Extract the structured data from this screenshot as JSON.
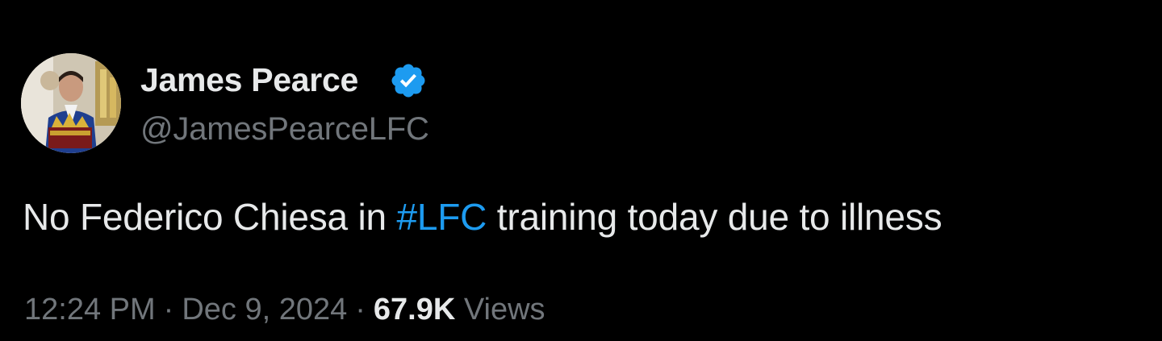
{
  "author": {
    "display_name": "James Pearce",
    "handle": "@JamesPearceLFC",
    "verified": true,
    "avatar_icon": "profile-photo"
  },
  "tweet": {
    "text_before": "No Federico Chiesa in ",
    "hashtag": "#LFC",
    "text_after": " training today due to illness"
  },
  "meta": {
    "time": "12:24 PM",
    "separator": "·",
    "date": "Dec 9, 2024",
    "views_count": "67.9K",
    "views_label": "Views"
  },
  "colors": {
    "background": "#000000",
    "primary_text": "#e7e9ea",
    "secondary_text": "#71767b",
    "accent": "#1d9bf0"
  }
}
